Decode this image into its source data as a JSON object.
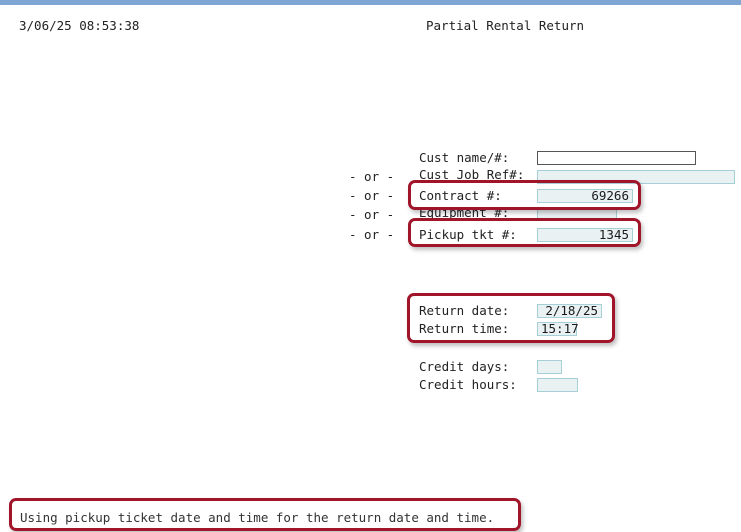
{
  "header": {
    "timestamp": "3/06/25 08:53:38",
    "title": "Partial Rental Return"
  },
  "or_label": "- or -",
  "lookup": {
    "cust_name_label": "Cust name/#:",
    "cust_name_value": "",
    "cust_job_label": "Cust Job Ref#:",
    "cust_job_value": "",
    "contract_label": "Contract #:",
    "contract_value": "69266",
    "equipment_label": "Equipment #:",
    "equipment_value": "",
    "pickup_label": "Pickup tkt #:",
    "pickup_value": "1345"
  },
  "return": {
    "date_label": "Return date:",
    "date_value": "2/18/25",
    "time_label": "Return time:",
    "time_value": "15:17"
  },
  "credit": {
    "days_label": "Credit days:",
    "days_value": "",
    "hours_label": "Credit hours:",
    "hours_value": ""
  },
  "status_message": "Using pickup ticket date and time for the return date and time.",
  "colors": {
    "highlight": "#a1152b",
    "top_bar": "#7fa7d6",
    "field_border": "#a7cfd6"
  }
}
